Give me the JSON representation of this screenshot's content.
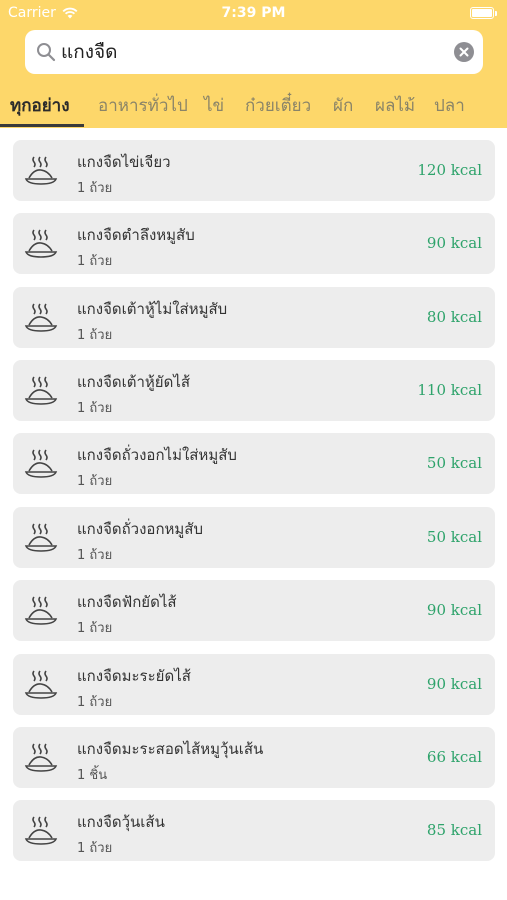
{
  "status_bar": {
    "carrier": "Carrier",
    "time": "7:39 PM"
  },
  "search": {
    "value": "แกงจืด",
    "placeholder": ""
  },
  "tabs": [
    {
      "label": "ทุกอย่าง",
      "active": true
    },
    {
      "label": "อาหารทั่วไป",
      "active": false
    },
    {
      "label": "ไข่",
      "active": false
    },
    {
      "label": "ก๋วยเตี๋ยว",
      "active": false
    },
    {
      "label": "ผัก",
      "active": false
    },
    {
      "label": "ผลไม้",
      "active": false
    },
    {
      "label": "ปลา",
      "active": false
    }
  ],
  "items": [
    {
      "name": "แกงจืดไข่เจียว",
      "portion": "1 ถ้วย",
      "kcal": "120 kcal"
    },
    {
      "name": "แกงจืดตำลึงหมูสับ",
      "portion": "1 ถ้วย",
      "kcal": "90 kcal"
    },
    {
      "name": "แกงจืดเต้าหู้ไม่ใส่หมูสับ",
      "portion": "1 ถ้วย",
      "kcal": "80 kcal"
    },
    {
      "name": "แกงจืดเต้าหู้ยัดไส้",
      "portion": "1 ถ้วย",
      "kcal": "110 kcal"
    },
    {
      "name": "แกงจืดถั่วงอกไม่ใส่หมูสับ",
      "portion": "1 ถ้วย",
      "kcal": "50 kcal"
    },
    {
      "name": "แกงจืดถั่วงอกหมูสับ",
      "portion": "1 ถ้วย",
      "kcal": "50 kcal"
    },
    {
      "name": "แกงจืดฟักยัดไส้",
      "portion": "1 ถ้วย",
      "kcal": "90 kcal"
    },
    {
      "name": "แกงจืดมะระยัดไส้",
      "portion": "1 ถ้วย",
      "kcal": "90 kcal"
    },
    {
      "name": "แกงจืดมะระสอดไส้หมูวุ้นเส้น",
      "portion": "1 ชิ้น",
      "kcal": "66 kcal"
    },
    {
      "name": "แกงจืดวุ้นเส้น",
      "portion": "1 ถ้วย",
      "kcal": "85 kcal"
    }
  ],
  "icons": {
    "wifi": "wifi-icon",
    "battery": "battery-icon",
    "search": "search-icon",
    "clear": "clear-icon",
    "food": "steaming-dish-icon"
  },
  "colors": {
    "header": "#fdd76a",
    "kcal": "#2ea36b",
    "card": "#ededed"
  }
}
